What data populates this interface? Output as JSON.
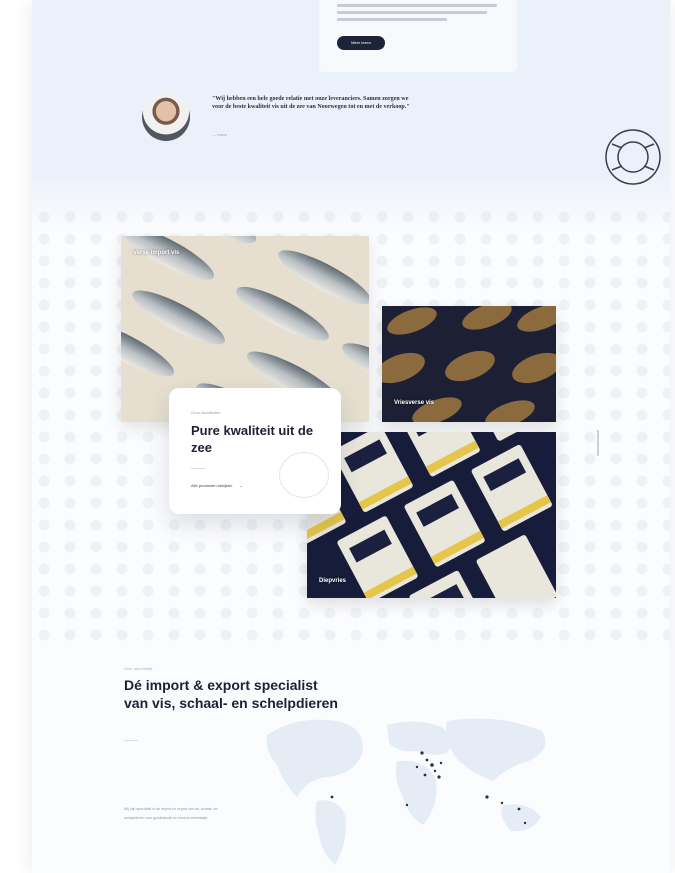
{
  "hero": {
    "button_label": "Meer lezen"
  },
  "testimonial": {
    "quote": "\"Wij hebben een hele goede relatie met onze leveranciers. Samen zorgen we voor de beste kwaliteit vis uit de zee van Noorwegen tot en met de verkoop.\"",
    "author": "— naam"
  },
  "products": {
    "cards": [
      {
        "label": "Verse import vis",
        "icon": "salmon-photo"
      },
      {
        "label": "Vriesverse vis",
        "icon": "plaice-photo"
      },
      {
        "label": "Diepvries",
        "icon": "ocean-pack-photo"
      }
    ],
    "kicker": "Onze kwaliteiten",
    "title": "Pure kwaliteit uit de zee",
    "link_label": "Alle producten bekijken"
  },
  "about": {
    "kicker": "Over ons bedrijf",
    "title": "Dé import & export specialist van vis, schaal- en schelpdieren",
    "body": "Wij zijn specialist in de import en export van vis, schaal- en schelpdieren voor groothandel en horeca wereldwijd."
  },
  "colors": {
    "accent_dark": "#1e2438",
    "background_light": "#eaf1fb"
  }
}
